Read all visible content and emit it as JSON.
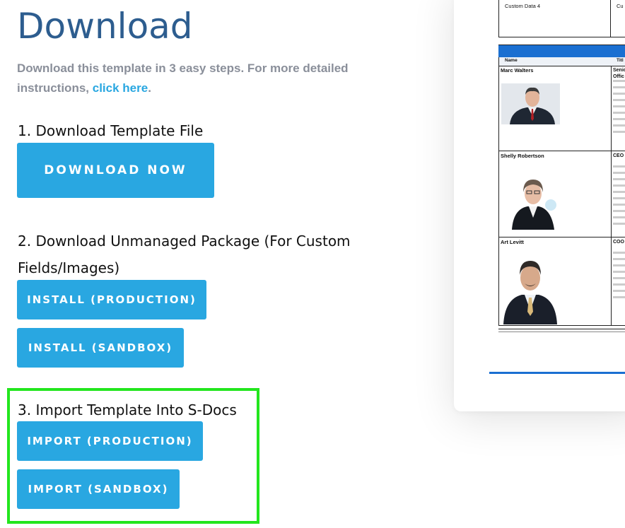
{
  "page": {
    "title": "Download"
  },
  "intro": {
    "text": "Download this template in 3 easy steps. For more detailed instructions, ",
    "link": "click here",
    "suffix": "."
  },
  "steps": [
    {
      "heading": "1. Download Template File",
      "buttons": [
        "DOWNLOAD NOW"
      ]
    },
    {
      "heading": "2. Download Unmanaged Package (For Custom Fields/Images)",
      "buttons": [
        "INSTALL (PRODUCTION)",
        "INSTALL (SANDBOX)"
      ]
    },
    {
      "heading": "3. Import Template Into S-Docs",
      "buttons": [
        "IMPORT (PRODUCTION)",
        "IMPORT (SANDBOX)"
      ]
    }
  ],
  "preview": {
    "custom_labels": [
      "Custom Data 4",
      "Cu"
    ],
    "columns": [
      "Name",
      "Titl"
    ],
    "people": [
      {
        "name": "Marc Walters",
        "title": "Senio\nOffic"
      },
      {
        "name": "Shelly Robertson",
        "title": "CEO"
      },
      {
        "name": "Art Levitt",
        "title": "COO"
      }
    ]
  },
  "colors": {
    "accent": "#29a7e1",
    "title": "#2d5d8f",
    "highlight": "#23e61e",
    "doc_blue": "#1a6fd1"
  }
}
